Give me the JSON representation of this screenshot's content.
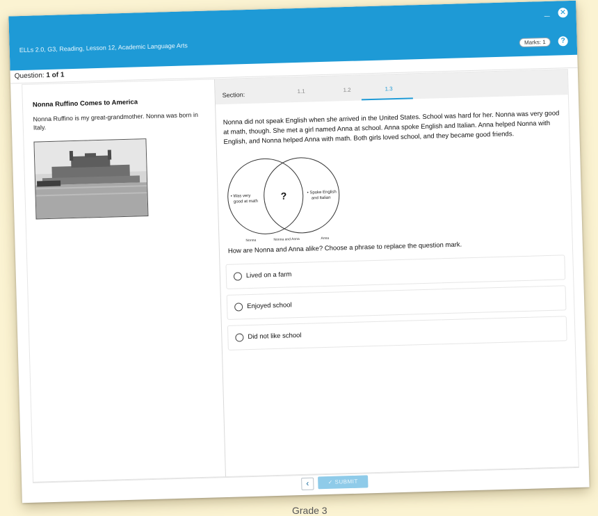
{
  "window": {
    "title": "ELLs 2.0, G3, Reading, Lesson 12, Academic Language Arts",
    "minimize_glyph": "_",
    "close_glyph": "✕",
    "marks_label": "Marks: 1",
    "help_glyph": "?"
  },
  "question_counter": {
    "label": "Question:",
    "value": "1 of 1"
  },
  "passage": {
    "title": "Nonna Ruffino Comes to America",
    "body": "Nonna Ruffino is my great-grandmother. Nonna was born in Italy."
  },
  "section": {
    "label": "Section:",
    "tabs": [
      {
        "label": "1.1",
        "active": false
      },
      {
        "label": "1.2",
        "active": false
      },
      {
        "label": "1.3",
        "active": true
      }
    ]
  },
  "story": "Nonna did not speak English when she arrived in the United States. School was hard for her. Nonna was very good at math, though. She met a girl named Anna at school. Anna spoke English and Italian. Anna helped Nonna with English, and Nonna helped Anna with math. Both girls loved school, and they became good friends.",
  "venn": {
    "left_text_1": "• Was very",
    "left_text_2": "good at math",
    "center_text": "?",
    "right_text_1": "• Spoke English",
    "right_text_2": "and Italian",
    "left_label": "Nonna",
    "center_label": "Nonna and Anna",
    "right_label": "Anna"
  },
  "question": "How are Nonna and Anna alike? Choose a phrase to replace the question mark.",
  "options": [
    {
      "label": "Lived on a farm",
      "selected": false
    },
    {
      "label": "Enjoyed school",
      "selected": false
    },
    {
      "label": "Did not like school",
      "selected": false
    }
  ],
  "footer": {
    "back_glyph": "‹",
    "submit_label": "✓  SUBMIT"
  },
  "below_text": "Grade 3",
  "colors": {
    "accent": "#1e9ad6",
    "background": "#fbf3d2",
    "submit_disabled": "#8fcbe9"
  }
}
